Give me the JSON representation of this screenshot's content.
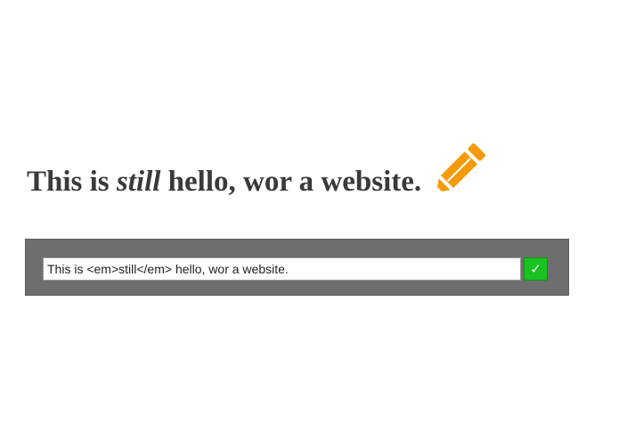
{
  "heading": {
    "part1": "This is ",
    "emphasis": "still",
    "part2": " hello, wor a website."
  },
  "editor": {
    "input_value": "This is <em>still</em> hello, wor a website.",
    "confirm_label": "✓"
  },
  "colors": {
    "pencil": "#f59b0b",
    "confirm": "#19c21f",
    "bar": "#6e6e6e"
  },
  "icons": {
    "edit": "pencil-icon",
    "confirm": "check-icon"
  }
}
